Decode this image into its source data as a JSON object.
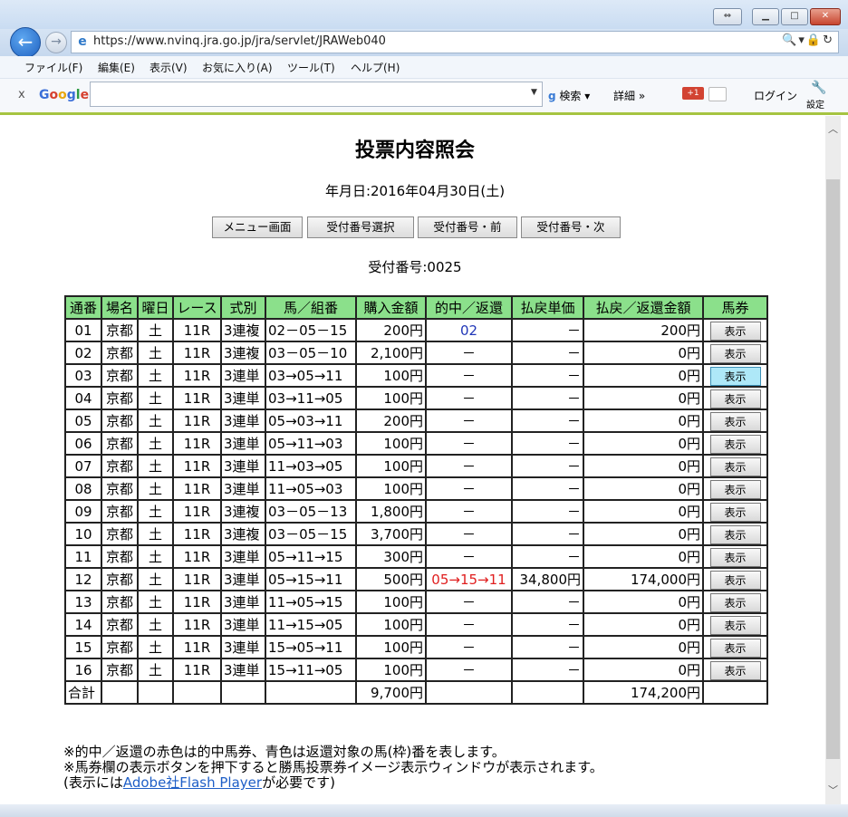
{
  "browser": {
    "url": "https://www.nvinq.jra.go.jp/jra/servlet/JRAWeb040",
    "address_right_icons": "🔍▾🔒↻",
    "menu": [
      "ファイル(F)",
      "編集(E)",
      "表示(V)",
      "お気に入り(A)",
      "ツール(T)",
      "ヘルプ(H)"
    ],
    "google_toolbar": {
      "close": "x",
      "logo": "Google",
      "search_label": "検索",
      "details_label": "詳細 »",
      "gplus": "+1",
      "login": "ログイン",
      "settings": "設定"
    }
  },
  "page": {
    "title": "投票内容照会",
    "date": "年月日:2016年04月30日(土)",
    "buttons": [
      "メニュー画面",
      "受付番号選択",
      "受付番号・前",
      "受付番号・次"
    ],
    "receipt": "受付番号:0025",
    "columns": [
      "通番",
      "場名",
      "曜日",
      "レース",
      "式別",
      "馬／組番",
      "購入金額",
      "的中／返還",
      "払戻単価",
      "払戻／返還金額",
      "馬券"
    ],
    "rows": [
      {
        "no": "01",
        "venue": "京都",
        "day": "土",
        "race": "11R",
        "type": "3連複",
        "combo": "02－05－15",
        "amount": "200円",
        "hit": "02",
        "hit_color": "blue",
        "unit": "－",
        "payout": "200円",
        "btn": "表示"
      },
      {
        "no": "02",
        "venue": "京都",
        "day": "土",
        "race": "11R",
        "type": "3連複",
        "combo": "03－05－10",
        "amount": "2,100円",
        "hit": "－",
        "hit_color": "",
        "unit": "－",
        "payout": "0円",
        "btn": "表示"
      },
      {
        "no": "03",
        "venue": "京都",
        "day": "土",
        "race": "11R",
        "type": "3連単",
        "combo": "03→05→11",
        "amount": "100円",
        "hit": "－",
        "hit_color": "",
        "unit": "－",
        "payout": "0円",
        "btn": "表示",
        "btn_highlight": true
      },
      {
        "no": "04",
        "venue": "京都",
        "day": "土",
        "race": "11R",
        "type": "3連単",
        "combo": "03→11→05",
        "amount": "100円",
        "hit": "－",
        "hit_color": "",
        "unit": "－",
        "payout": "0円",
        "btn": "表示"
      },
      {
        "no": "05",
        "venue": "京都",
        "day": "土",
        "race": "11R",
        "type": "3連単",
        "combo": "05→03→11",
        "amount": "200円",
        "hit": "－",
        "hit_color": "",
        "unit": "－",
        "payout": "0円",
        "btn": "表示"
      },
      {
        "no": "06",
        "venue": "京都",
        "day": "土",
        "race": "11R",
        "type": "3連単",
        "combo": "05→11→03",
        "amount": "100円",
        "hit": "－",
        "hit_color": "",
        "unit": "－",
        "payout": "0円",
        "btn": "表示"
      },
      {
        "no": "07",
        "venue": "京都",
        "day": "土",
        "race": "11R",
        "type": "3連単",
        "combo": "11→03→05",
        "amount": "100円",
        "hit": "－",
        "hit_color": "",
        "unit": "－",
        "payout": "0円",
        "btn": "表示"
      },
      {
        "no": "08",
        "venue": "京都",
        "day": "土",
        "race": "11R",
        "type": "3連単",
        "combo": "11→05→03",
        "amount": "100円",
        "hit": "－",
        "hit_color": "",
        "unit": "－",
        "payout": "0円",
        "btn": "表示"
      },
      {
        "no": "09",
        "venue": "京都",
        "day": "土",
        "race": "11R",
        "type": "3連複",
        "combo": "03－05－13",
        "amount": "1,800円",
        "hit": "－",
        "hit_color": "",
        "unit": "－",
        "payout": "0円",
        "btn": "表示"
      },
      {
        "no": "10",
        "venue": "京都",
        "day": "土",
        "race": "11R",
        "type": "3連複",
        "combo": "03－05－15",
        "amount": "3,700円",
        "hit": "－",
        "hit_color": "",
        "unit": "－",
        "payout": "0円",
        "btn": "表示"
      },
      {
        "no": "11",
        "venue": "京都",
        "day": "土",
        "race": "11R",
        "type": "3連単",
        "combo": "05→11→15",
        "amount": "300円",
        "hit": "－",
        "hit_color": "",
        "unit": "－",
        "payout": "0円",
        "btn": "表示"
      },
      {
        "no": "12",
        "venue": "京都",
        "day": "土",
        "race": "11R",
        "type": "3連単",
        "combo": "05→15→11",
        "amount": "500円",
        "hit": "05→15→11",
        "hit_color": "red",
        "unit": "34,800円",
        "payout": "174,000円",
        "btn": "表示"
      },
      {
        "no": "13",
        "venue": "京都",
        "day": "土",
        "race": "11R",
        "type": "3連単",
        "combo": "11→05→15",
        "amount": "100円",
        "hit": "－",
        "hit_color": "",
        "unit": "－",
        "payout": "0円",
        "btn": "表示"
      },
      {
        "no": "14",
        "venue": "京都",
        "day": "土",
        "race": "11R",
        "type": "3連単",
        "combo": "11→15→05",
        "amount": "100円",
        "hit": "－",
        "hit_color": "",
        "unit": "－",
        "payout": "0円",
        "btn": "表示"
      },
      {
        "no": "15",
        "venue": "京都",
        "day": "土",
        "race": "11R",
        "type": "3連単",
        "combo": "15→05→11",
        "amount": "100円",
        "hit": "－",
        "hit_color": "",
        "unit": "－",
        "payout": "0円",
        "btn": "表示"
      },
      {
        "no": "16",
        "venue": "京都",
        "day": "土",
        "race": "11R",
        "type": "3連単",
        "combo": "15→11→05",
        "amount": "100円",
        "hit": "－",
        "hit_color": "",
        "unit": "－",
        "payout": "0円",
        "btn": "表示"
      }
    ],
    "total": {
      "label": "合計",
      "amount": "9,700円",
      "payout": "174,200円"
    },
    "notes": [
      "※的中／返還の赤色は的中馬券、青色は返還対象の馬(枠)番を表します。",
      "※馬券欄の表示ボタンを押下すると勝馬投票券イメージ表示ウィンドウが表示されます。"
    ],
    "note3_prefix": "(表示には",
    "note3_link": "Adobe社Flash Player",
    "note3_suffix": "が必要です)"
  },
  "colors": {
    "header_bg": "#8be08b",
    "hit_red": "#e01e1e",
    "refund_blue": "#2137b8",
    "toolbar_accent": "#a6c441"
  }
}
